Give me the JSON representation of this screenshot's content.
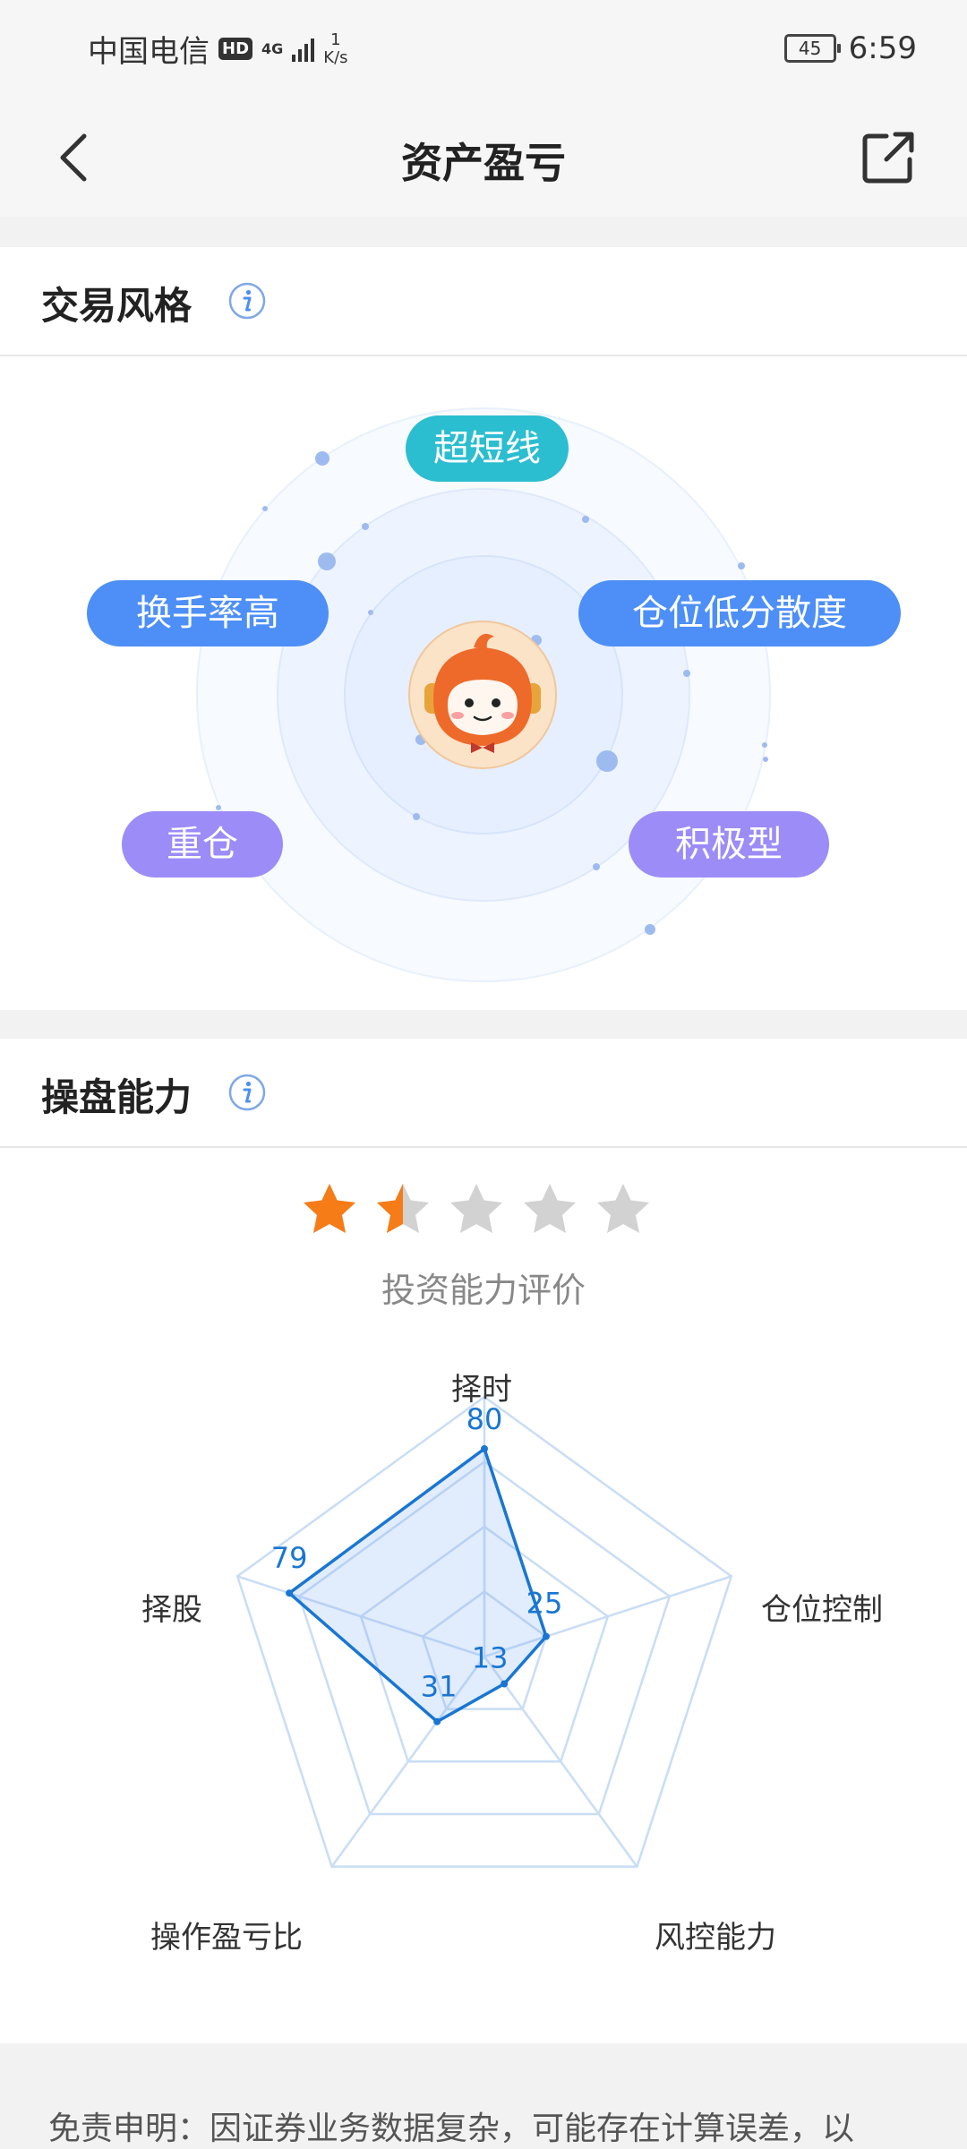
{
  "status_bar": {
    "carrier": "中国电信",
    "hd": "HD",
    "network": "4G",
    "speed_value": "1",
    "speed_unit": "K/s",
    "battery": "45",
    "time": "6:59"
  },
  "nav": {
    "title": "资产盈亏"
  },
  "trading_style": {
    "title": "交易风格",
    "tags": [
      {
        "label": "超短线",
        "color": "#2bbdd0"
      },
      {
        "label": "换手率高",
        "color": "#4d8ff7"
      },
      {
        "label": "仓位低分散度",
        "color": "#4d8ff7"
      },
      {
        "label": "重仓",
        "color": "#9b8cf7"
      },
      {
        "label": "积极型",
        "color": "#9b8cf7"
      }
    ]
  },
  "operation_ability": {
    "title": "操盘能力",
    "rating": {
      "stars": 1.5,
      "max": 5,
      "label": "投资能力评价"
    }
  },
  "chart_data": {
    "type": "radar",
    "axes": [
      "择时",
      "仓位控制",
      "风控能力",
      "操作盈亏比",
      "择股"
    ],
    "values": [
      80,
      25,
      13,
      31,
      79
    ],
    "max": 100,
    "color": "#1976d2"
  },
  "disclaimer": {
    "text": "免责申明：因证券业务数据复杂，可能存在计算误差，以"
  }
}
